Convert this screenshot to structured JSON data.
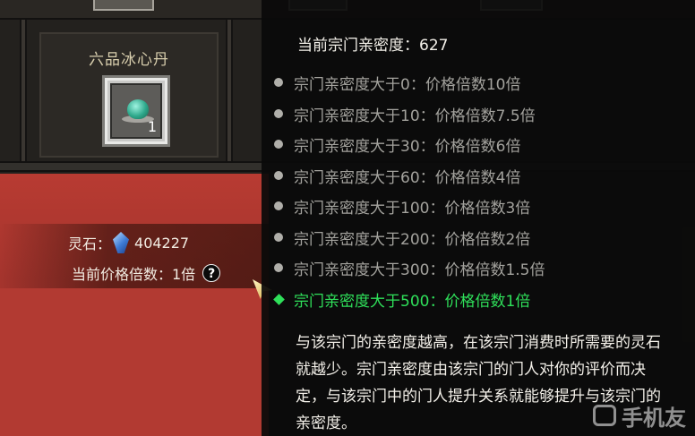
{
  "shop": {
    "item": {
      "name": "六品冰心丹",
      "count": "1"
    },
    "spirit_stone": {
      "label": "灵石：",
      "value": "404227"
    },
    "multiplier": {
      "label": "当前价格倍数：1倍",
      "help": "?"
    }
  },
  "tooltip": {
    "heading": "当前宗门亲密度：627",
    "tiers": [
      {
        "text": "宗门亲密度大于0：价格倍数10倍",
        "active": false
      },
      {
        "text": "宗门亲密度大于10：价格倍数7.5倍",
        "active": false
      },
      {
        "text": "宗门亲密度大于30：价格倍数6倍",
        "active": false
      },
      {
        "text": "宗门亲密度大于60：价格倍数4倍",
        "active": false
      },
      {
        "text": "宗门亲密度大于100：价格倍数3倍",
        "active": false
      },
      {
        "text": "宗门亲密度大于200：价格倍数2倍",
        "active": false
      },
      {
        "text": "宗门亲密度大于300：价格倍数1.5倍",
        "active": false
      },
      {
        "text": "宗门亲密度大于500：价格倍数1倍",
        "active": true
      }
    ],
    "description": "与该宗门的亲密度越高，在该宗门消费时所需要的灵石就越少。宗门亲密度由该宗门的门人对你的评价而决定，与该宗门中的门人提升关系就能够提升与该宗门的亲密度。"
  },
  "watermark": {
    "text": "手机友"
  },
  "colors": {
    "active_tier": "#2fe05a",
    "inactive_tier": "#a3a29d",
    "red_panel": "#b23a32"
  }
}
